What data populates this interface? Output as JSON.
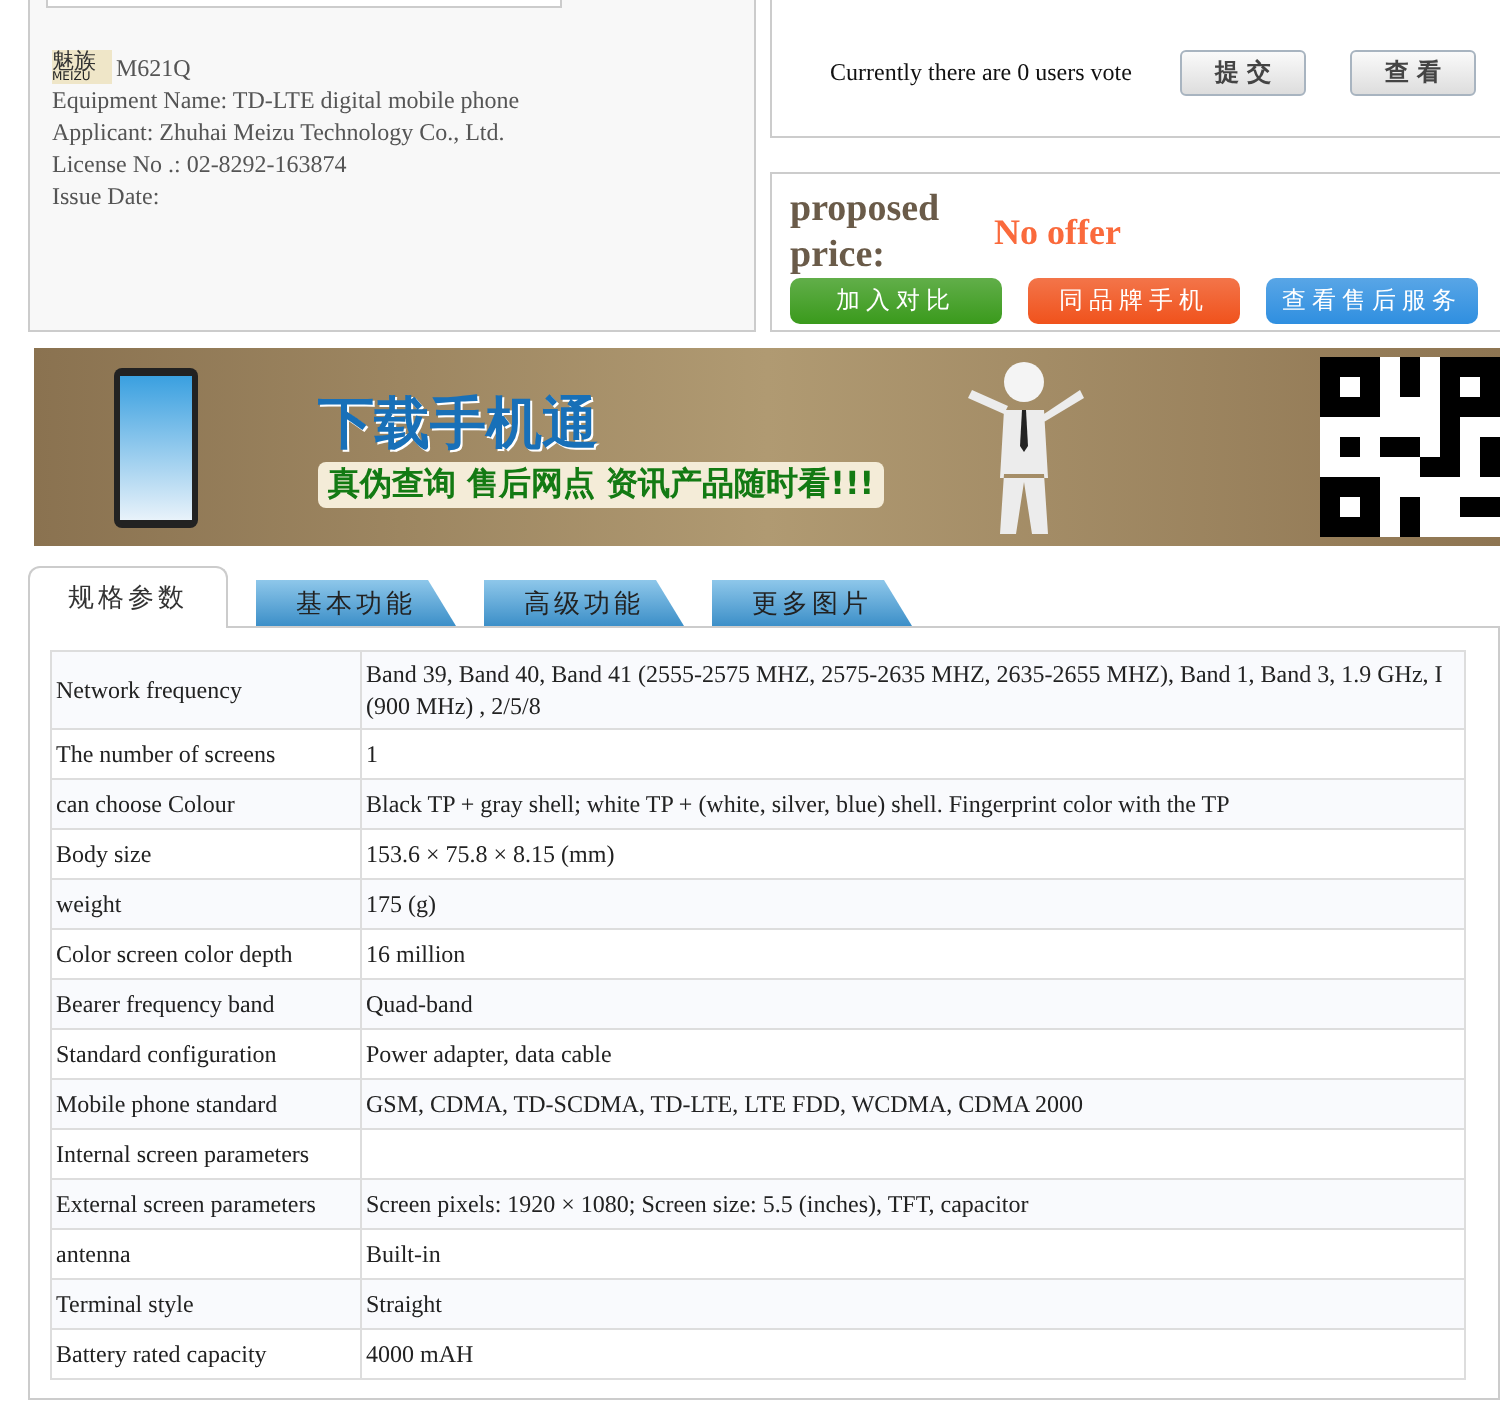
{
  "device": {
    "logo": "魅族",
    "logo_sub": "MEIZU",
    "model": "M621Q",
    "lines": [
      "Equipment Name: TD-LTE digital mobile phone",
      "Applicant: Zhuhai Meizu Technology Co., Ltd.",
      "License No .: 02-8292-163874",
      "Issue Date:"
    ]
  },
  "vote": {
    "text": "Currently there are 0 users vote",
    "buttons": [
      "提 交",
      "查 看"
    ]
  },
  "price": {
    "label": "proposed price:",
    "value": "No offer",
    "buttons": [
      {
        "label": "加入对比",
        "color": "#3a9a1c"
      },
      {
        "label": "同品牌手机",
        "color": "#f0521c"
      },
      {
        "label": "查看售后服务",
        "color": "#2f8fe0"
      }
    ]
  },
  "banner": {
    "title": "下载手机通",
    "subtitle": "真伪查询 售后网点 资讯产品随时看!!!"
  },
  "tabs": [
    {
      "label": "规格参数",
      "selected": true
    },
    {
      "label": "基本功能",
      "selected": false
    },
    {
      "label": "高级功能",
      "selected": false
    },
    {
      "label": "更多图片",
      "selected": false
    }
  ],
  "specs": [
    {
      "name": "Network frequency",
      "value": "Band 39, Band 40, Band 41 (2555-2575 MHZ, 2575-2635 MHZ, 2635-2655 MHZ), Band 1, Band 3, 1.9 GHz, I (900 MHz) , 2/5/8"
    },
    {
      "name": "The number of screens",
      "value": "1"
    },
    {
      "name": "can choose Colour",
      "value": "Black TP + gray shell; white TP + (white, silver, blue) shell. Fingerprint color with the TP"
    },
    {
      "name": "Body size",
      "value": "153.6 × 75.8 × 8.15 (mm)"
    },
    {
      "name": "weight",
      "value": "175 (g)"
    },
    {
      "name": "Color screen color depth",
      "value": "16 million"
    },
    {
      "name": "Bearer frequency band",
      "value": "Quad-band"
    },
    {
      "name": "Standard configuration",
      "value": "Power adapter, data cable"
    },
    {
      "name": "Mobile phone standard",
      "value": "GSM, CDMA, TD-SCDMA, TD-LTE, LTE FDD, WCDMA, CDMA 2000"
    },
    {
      "name": "Internal screen parameters"
    },
    {
      "name": "External screen parameters",
      "value": "Screen pixels: 1920 × 1080; Screen size: 5.5 (inches), TFT, capacitor"
    },
    {
      "name": "antenna",
      "value": "Built-in"
    },
    {
      "name": "Terminal style",
      "value": "Straight"
    },
    {
      "name": "Battery rated capacity",
      "value": "4000 mAH"
    }
  ]
}
